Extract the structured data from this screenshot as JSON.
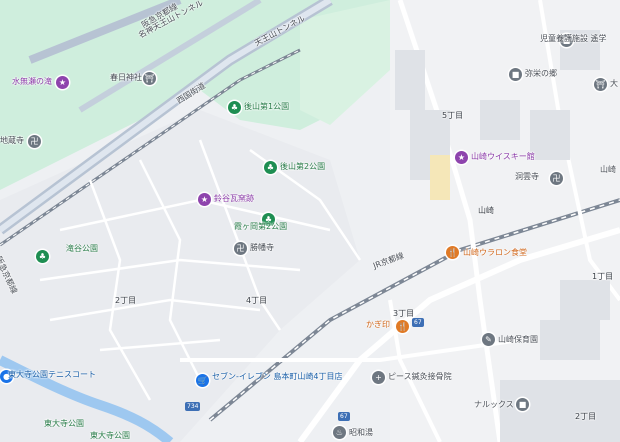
{
  "map": {
    "roads": {
      "hankyu": "阪急京都線",
      "hankyu2": "阪急京都線",
      "meishin_tunnel": "名神天王山トンネル",
      "tenno_tunnel": "天王山トンネル",
      "west_highway": "西国街道",
      "jr_line": "JR京都線",
      "route67": "67",
      "route734": "734"
    },
    "districts": {
      "d5": "5丁目",
      "d4": "4丁目",
      "d3": "3丁目",
      "d2a": "2丁目",
      "d2b": "2丁目",
      "d1": "1丁目",
      "yamazaki": "山崎"
    },
    "pois": [
      {
        "name": "水無瀬の滝",
        "icon": "attraction-icon",
        "color": "purple"
      },
      {
        "name": "春日神社",
        "icon": "shrine-icon",
        "color": "gray"
      },
      {
        "name": "後山第1公園",
        "icon": "park-icon",
        "color": "green"
      },
      {
        "name": "後山第2公園",
        "icon": "park-icon",
        "color": "green"
      },
      {
        "name": "鈴谷瓦窯跡",
        "icon": "attraction-icon",
        "color": "purple"
      },
      {
        "name": "霞ヶ岡第2公園",
        "icon": "park-icon",
        "color": "green"
      },
      {
        "name": "勝幡寺",
        "icon": "temple-icon",
        "color": "gray"
      },
      {
        "name": "滝谷公園",
        "icon": "park-icon",
        "color": "green"
      },
      {
        "name": "地蔵寺",
        "icon": "temple-icon",
        "color": "gray"
      },
      {
        "name": "東大寺公園テニスコート",
        "icon": "tennis-icon",
        "color": "blue"
      },
      {
        "name": "東大寺公園",
        "icon": "park-icon",
        "color": "green"
      },
      {
        "name": "東大寺公園",
        "icon": "park-icon",
        "color": "green"
      },
      {
        "name": "児童養護施設 遙学",
        "icon": "building-icon",
        "color": "gray"
      },
      {
        "name": "弥栄の郷",
        "icon": "building-icon",
        "color": "gray"
      },
      {
        "name": "山崎ウイスキー館",
        "icon": "attraction-icon",
        "color": "purple"
      },
      {
        "name": "洞雲寺",
        "icon": "temple-icon",
        "color": "gray"
      },
      {
        "name": "山崎ウラロン食堂",
        "icon": "restaurant-icon",
        "color": "orange"
      },
      {
        "name": "かぎ印",
        "icon": "restaurant-icon",
        "color": "orange"
      },
      {
        "name": "山崎保育園",
        "icon": "school-icon",
        "color": "gray"
      },
      {
        "name": "セブン-イレブン 島本町山崎4丁目店",
        "icon": "convenience-store-icon",
        "color": "blue"
      },
      {
        "name": "ピース鍼灸接骨院",
        "icon": "clinic-icon",
        "color": "gray"
      },
      {
        "name": "ナルックス",
        "icon": "building-icon",
        "color": "gray"
      },
      {
        "name": "昭和湯",
        "icon": "bath-icon",
        "color": "gray"
      },
      {
        "name": "大",
        "icon": "shrine-icon",
        "color": "gray"
      },
      {
        "name": "山崎",
        "icon": "building-icon",
        "color": "gray"
      }
    ]
  }
}
